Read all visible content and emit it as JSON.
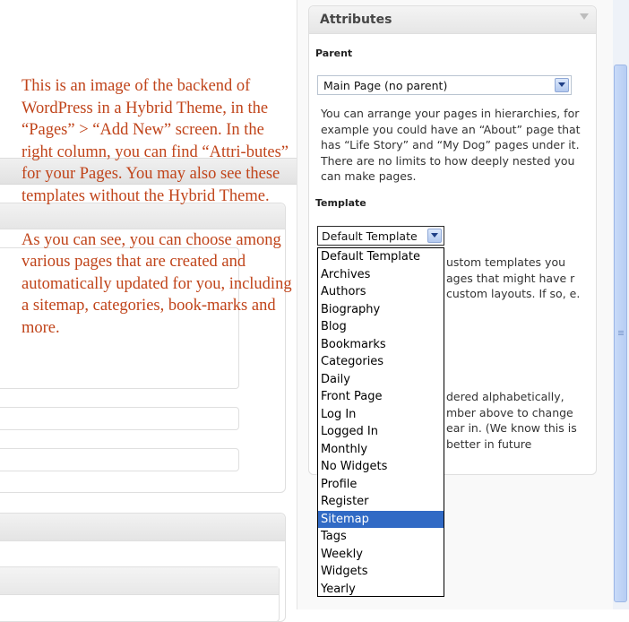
{
  "annotation": {
    "paragraph1": "This is an image of the backend of WordPress in a Hybrid Theme, in the “Pages” > “Add New” screen. In the right column, you can find “Attri-butes” for your Pages. You may also see these templates without the Hybrid Theme.",
    "paragraph2": "As you can see, you can choose among various pages that are created and automatically updated for you, including a sitemap, categories, book-marks and more."
  },
  "attributes": {
    "title": "Attributes",
    "parent_label": "Parent",
    "parent_value": "Main Page (no parent)",
    "parent_help": "You can arrange your pages in hierarchies, for example you could have an “About” page that has “Life Story” and “My Dog” pages under it. There are no limits to how deeply nested you can make pages.",
    "template_label": "Template",
    "template_value": "Default Template",
    "template_help_fragment": "ustom templates you ages that might have r custom layouts. If so, e.",
    "order_help_fragment": "dered alphabetically, mber above to change ear in. (We know this is better in future",
    "template_options": [
      "Default Template",
      "Archives",
      "Authors",
      "Biography",
      "Blog",
      "Bookmarks",
      "Categories",
      "Daily",
      "Front Page",
      "Log In",
      "Logged In",
      "Monthly",
      "No Widgets",
      "Profile",
      "Register",
      "Sitemap",
      "Tags",
      "Weekly",
      "Widgets",
      "Yearly"
    ],
    "selected_option": "Sitemap"
  },
  "colors": {
    "annotation_text": "#c0441a",
    "selected_option_bg": "#316ac5"
  }
}
